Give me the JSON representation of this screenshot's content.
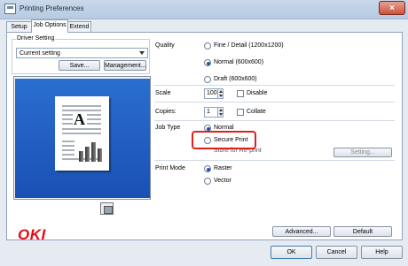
{
  "window": {
    "title": "Printing Preferences",
    "close_symbol": "×"
  },
  "tabs": [
    {
      "label": "Setup",
      "active": false
    },
    {
      "label": "Job Options",
      "active": true
    },
    {
      "label": "Extend",
      "active": false
    }
  ],
  "driver_setting": {
    "label": "Driver Setting",
    "selected": "Current setting",
    "save_label": "Save...",
    "management_label": "Management..."
  },
  "preview": {
    "letter": "A"
  },
  "logo": "OKI",
  "quality": {
    "label": "Quality",
    "options": [
      {
        "label": "Fine / Detail (1200x1200)",
        "selected": false
      },
      {
        "label": "Normal (600x600)",
        "selected": true
      },
      {
        "label": "Draft (600x600)",
        "selected": false
      }
    ]
  },
  "scale": {
    "label": "Scale",
    "value": "100",
    "disable_label": "Disable",
    "disable_checked": false
  },
  "copies": {
    "label": "Copies:",
    "value": "1",
    "collate_label": "Collate",
    "collate_checked": false
  },
  "job_type": {
    "label": "Job Type",
    "options": [
      {
        "label": "Normal",
        "selected": true
      },
      {
        "label": "Secure Print",
        "selected": false
      },
      {
        "label": "Store for Re-print",
        "selected": false
      }
    ],
    "setting_label": "Setting..."
  },
  "print_mode": {
    "label": "Print Mode",
    "options": [
      {
        "label": "Raster",
        "selected": true
      },
      {
        "label": "Vector",
        "selected": false
      }
    ]
  },
  "buttons": {
    "advanced": "Advanced...",
    "default": "Default",
    "ok": "OK",
    "cancel": "Cancel",
    "help": "Help"
  },
  "colors": {
    "accent": "#1c4fb0",
    "highlight": "#e0211c",
    "logo": "#e20a16",
    "preview_bg": "#1a50b3"
  }
}
